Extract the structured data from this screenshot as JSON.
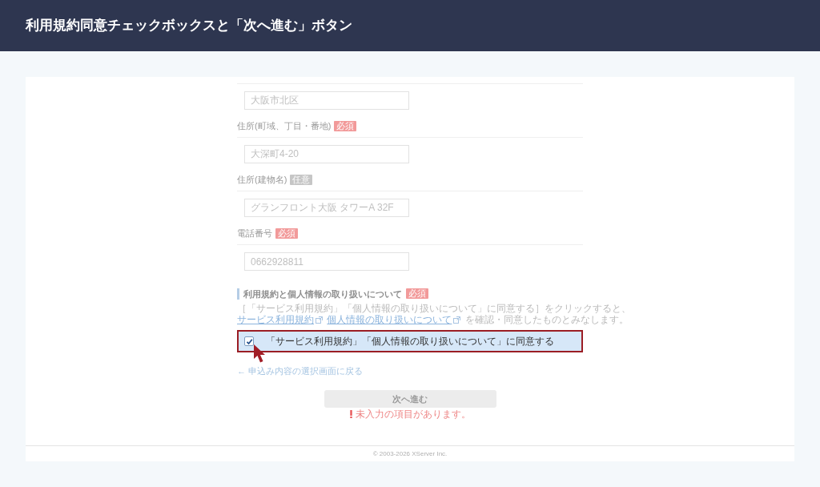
{
  "header": {
    "title": "利用規約同意チェックボックスと「次へ進む」ボタン"
  },
  "fields": [
    {
      "value": "大阪市北区"
    },
    {
      "label": "住所(町域、丁目・番地)",
      "badge": "必須",
      "required": true,
      "value": "大深町4-20"
    },
    {
      "label": "住所(建物名)",
      "badge": "任意",
      "required": false,
      "value": "グランフロント大阪 タワーA 32F"
    },
    {
      "label": "電話番号",
      "badge": "必須",
      "required": true,
      "value": "0662928811"
    }
  ],
  "terms": {
    "heading": "利用規約と個人情報の取り扱いについて",
    "badge": "必須",
    "required": true,
    "notice_intro": "［「サービス利用規約」「個人情報の取り扱いについて」に同意する］をクリックすると、",
    "links": [
      "サービス利用規約",
      "個人情報の取り扱いについて"
    ],
    "notice_outro": "を確認・同意したものとみなします。",
    "agree": {
      "label": "「サービス利用規約」「個人情報の取り扱いについて」に同意する",
      "checked": true
    }
  },
  "back_link": "← 申込み内容の選択画面に戻る",
  "next_button": {
    "label": "次へ進む",
    "disabled": true
  },
  "error": "未入力の項目があります。",
  "footer": "© 2003-2026 XServer Inc."
}
